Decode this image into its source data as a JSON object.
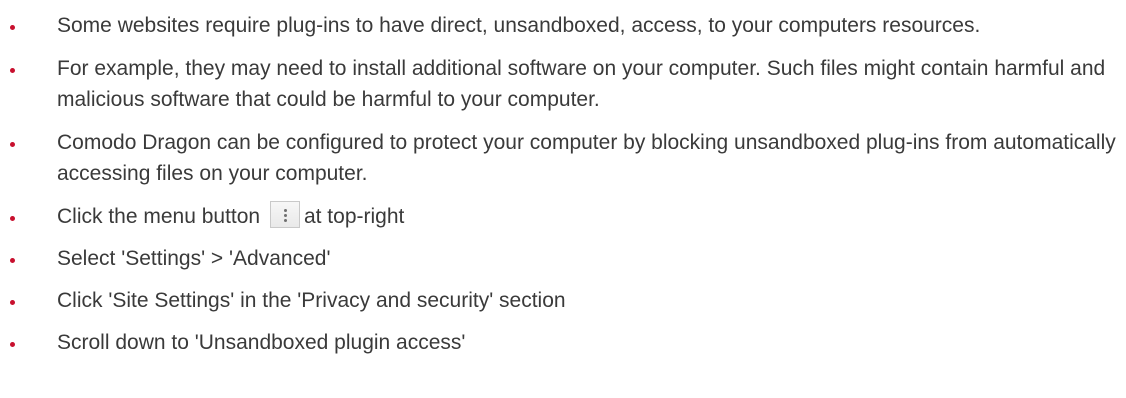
{
  "colors": {
    "bullet": "#c8102e",
    "text": "#3a3a3a"
  },
  "bullets": [
    {
      "text": "Some websites require plug-ins to have direct, unsandboxed, access, to your computers resources."
    },
    {
      "text": "For example, they may need to install additional software on your computer. Such files might contain harmful and malicious software that could be harmful to your computer."
    },
    {
      "text": "Comodo Dragon can be configured to protect your computer by blocking unsandboxed plug-ins from automatically accessing files on your computer."
    },
    {
      "text_before": "Click the menu button",
      "icon": "vertical-dots-menu-icon",
      "text_after": "at  top-right"
    },
    {
      "text": "Select 'Settings' > 'Advanced'"
    },
    {
      "text": "Click 'Site Settings' in the 'Privacy and security' section"
    },
    {
      "text": "Scroll down to 'Unsandboxed plugin access'"
    }
  ]
}
